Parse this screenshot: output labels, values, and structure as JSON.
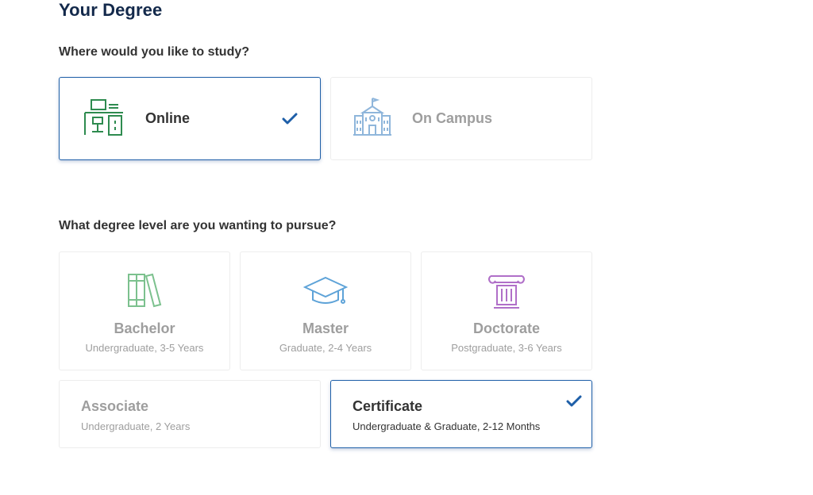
{
  "page": {
    "title": "Your Degree"
  },
  "study_location": {
    "question": "Where would you like to study?",
    "options": [
      {
        "label": "Online",
        "icon": "desk-computer-icon",
        "selected": true
      },
      {
        "label": "On Campus",
        "icon": "campus-building-icon",
        "selected": false
      }
    ]
  },
  "degree_level": {
    "question": "What degree level are you wanting to pursue?",
    "options": [
      {
        "name": "Bachelor",
        "description": "Undergraduate, 3-5 Years",
        "icon": "books-icon",
        "selected": false
      },
      {
        "name": "Master",
        "description": "Graduate, 2-4 Years",
        "icon": "graduation-cap-icon",
        "selected": false
      },
      {
        "name": "Doctorate",
        "description": "Postgraduate, 3-6 Years",
        "icon": "ionic-column-icon",
        "selected": false
      },
      {
        "name": "Associate",
        "description": "Undergraduate, 2 Years",
        "selected": false
      },
      {
        "name": "Certificate",
        "description": "Undergraduate & Graduate, 2-12 Months",
        "selected": true
      }
    ]
  },
  "colors": {
    "title": "#13294b",
    "selected_border": "#1e5fa8",
    "check": "#1e5fa8",
    "online_icon": "#2e8b4f",
    "campus_icon": "#8fb6db",
    "bachelor_icon": "#7cc18e",
    "master_icon": "#5ea3d8",
    "doctorate_icon": "#b06fc8",
    "muted_text": "#9e9e9e"
  }
}
